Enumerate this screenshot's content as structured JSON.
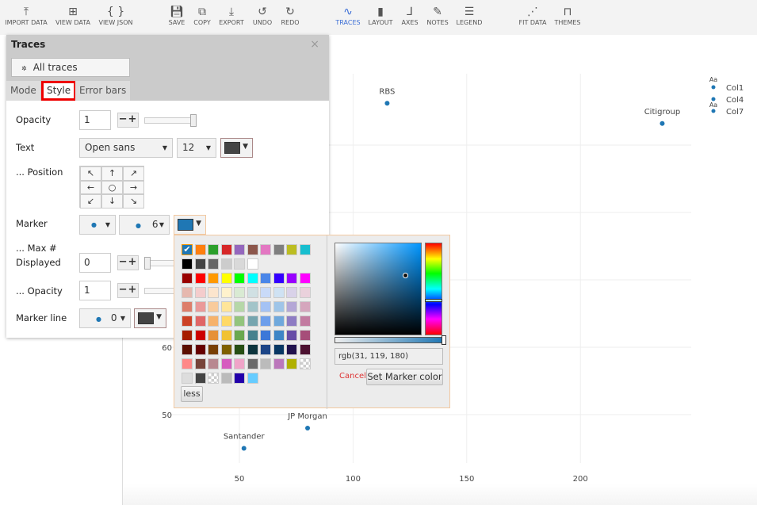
{
  "toolbar": {
    "items": [
      {
        "label": "IMPORT DATA",
        "icon": "upload-icon",
        "glyph": "⤒"
      },
      {
        "label": "VIEW DATA",
        "icon": "grid-icon",
        "glyph": "⊞"
      },
      {
        "label": "VIEW JSON",
        "icon": "braces-icon",
        "glyph": "{ }"
      },
      {
        "label": "SAVE",
        "icon": "save-icon",
        "glyph": "💾︎"
      },
      {
        "label": "COPY",
        "icon": "copy-icon",
        "glyph": "⧉"
      },
      {
        "label": "EXPORT",
        "icon": "download-icon",
        "glyph": "⤓"
      },
      {
        "label": "UNDO",
        "icon": "undo-icon",
        "glyph": "↺"
      },
      {
        "label": "REDO",
        "icon": "redo-icon",
        "glyph": "↻"
      },
      {
        "label": "TRACES",
        "icon": "traces-icon",
        "glyph": "∿",
        "active": true
      },
      {
        "label": "LAYOUT",
        "icon": "document-icon",
        "glyph": "▮"
      },
      {
        "label": "AXES",
        "icon": "axes-icon",
        "glyph": "⅃"
      },
      {
        "label": "NOTES",
        "icon": "pencil-icon",
        "glyph": "✎"
      },
      {
        "label": "LEGEND",
        "icon": "list-icon",
        "glyph": "☰"
      },
      {
        "label": "FIT DATA",
        "icon": "fit-data-icon",
        "glyph": "⋰"
      },
      {
        "label": "THEMES",
        "icon": "paint-roller-icon",
        "glyph": "⊓"
      }
    ]
  },
  "panel": {
    "title": "Traces",
    "close": "×",
    "trace_select": "All traces (scatter)",
    "tabs": [
      "Mode",
      "Style",
      "Error bars"
    ],
    "active_tab": "Style",
    "opacity_label": "Opacity",
    "opacity_value": "1",
    "text_label": "Text",
    "font_value": "Open sans",
    "font_size": "12",
    "text_color": "#444444",
    "position_label": "... Position",
    "position_arrows": [
      "↖",
      "↑",
      "↗",
      "←",
      "○",
      "→",
      "↙",
      "↓",
      "↘"
    ],
    "marker_label": "Marker",
    "marker_symbol": "●",
    "marker_size": "6",
    "marker_color": "#1f77b4",
    "maxdisp_label1": "... Max #",
    "maxdisp_label2": "Displayed",
    "maxdisp_value": "0",
    "marker_opacity_label": "... Opacity",
    "marker_opacity_value": "1",
    "marker_line_label": "Marker line",
    "marker_line_width": "0",
    "marker_line_color": "#444444",
    "opacity_slider": 1.0,
    "maxdisp_slider": 0.0
  },
  "picker": {
    "swatch_rows": [
      [
        "#1f77b4",
        "#ff7f0e",
        "#2ca02c",
        "#d62728",
        "#9467bd",
        "#8c564b",
        "#e377c2",
        "#7f7f7f",
        "#bcbd22",
        "#17becf"
      ],
      [
        "#000000",
        "#444444",
        "#666666",
        "#cccccc",
        "#d9d9d9",
        "#ffffff"
      ],
      [
        "#980000",
        "#ff0000",
        "#ff9900",
        "#ffff00",
        "#00ff00",
        "#00ffff",
        "#4a86e8",
        "#3300ff",
        "#9900ff",
        "#ff00ff"
      ],
      [
        "#e6b8af",
        "#f4cccc",
        "#fce5cd",
        "#fff2cc",
        "#d9ead3",
        "#d0e0e3",
        "#c9daf8",
        "#cfe2f3",
        "#d9d2e9",
        "#ead1dc"
      ],
      [
        "#dd7e6b",
        "#ea9999",
        "#f9cb9c",
        "#ffe599",
        "#b6d7a8",
        "#a2c4c9",
        "#a4c2f4",
        "#9fc5e8",
        "#b4a7d6",
        "#d5a6bd"
      ],
      [
        "#cc4125",
        "#e06666",
        "#f6b26b",
        "#ffd966",
        "#93c47d",
        "#76a5af",
        "#6d9eeb",
        "#6fa8dc",
        "#8e7cc3",
        "#c27ba0"
      ],
      [
        "#a61c00",
        "#cc0000",
        "#e69138",
        "#f1c232",
        "#6aa84f",
        "#45818e",
        "#3c78d8",
        "#3d85c6",
        "#674ea7",
        "#a64d79"
      ],
      [
        "#5b0f00",
        "#660000",
        "#783f04",
        "#7f6000",
        "#274e13",
        "#0c343d",
        "#1c4587",
        "#073763",
        "#20124d",
        "#4c1130"
      ],
      [
        "#ff8888",
        "#77443a",
        "#b88890",
        "#d65cbf",
        "#f0a4c8",
        "#6a6a6a",
        "#bbbbbb",
        "#bb77bb",
        "#b0b000",
        "transparent"
      ],
      [
        "#dddddd",
        "#444444",
        "transparent",
        "#bbbbbb",
        "#2200aa",
        "#66ccff"
      ]
    ],
    "selected_color": "#1f77b4",
    "value": "rgb(31, 119, 180)",
    "cancel": "Cancel",
    "set": "Set Marker color",
    "less": "less"
  },
  "chart_data": {
    "type": "scatter",
    "x_ticks": [
      50,
      100,
      150,
      200
    ],
    "y_ticks_visible": [
      50,
      60
    ],
    "xlim": [
      18,
      250
    ],
    "ylim": [
      40,
      100
    ],
    "grid": true,
    "marker_color": "#1f77b4",
    "points": [
      {
        "label": "RBS",
        "x": 115,
        "y": 96.2
      },
      {
        "label": "Citigroup",
        "x": 236,
        "y": 93.2
      },
      {
        "label": "JP Morgan",
        "x": 80,
        "y": 48
      },
      {
        "label": "Santander",
        "x": 52,
        "y": 45
      }
    ],
    "legend": {
      "placement": "top-right",
      "entries": [
        "Col1",
        "Col4",
        "Col7"
      ],
      "markers": [
        "Aa",
        "Aa"
      ]
    }
  }
}
